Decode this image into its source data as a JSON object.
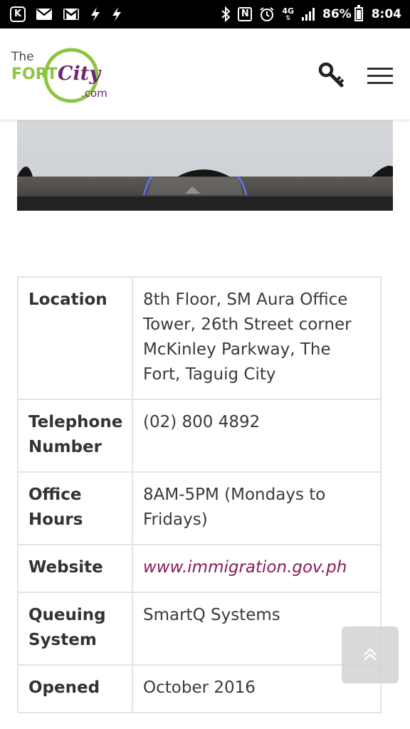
{
  "status_bar": {
    "left_icons": [
      "k-app-icon",
      "mail-icon",
      "gmail-icon",
      "flash-icon",
      "flash-icon"
    ],
    "right_icons": [
      "bluetooth-icon",
      "nfc-icon",
      "alarm-icon",
      "network-icon",
      "signal-icon",
      "battery-icon"
    ],
    "network_label": "4G",
    "battery_percent": "86%",
    "time": "8:04"
  },
  "header": {
    "logo": {
      "the": "The",
      "fort": "FORT",
      "city": "City",
      "dotcom": ".com"
    },
    "search_icon": "key-search-icon",
    "menu_icon": "hamburger-menu-icon"
  },
  "info_table": {
    "rows": [
      {
        "label": "Location",
        "value": "8th Floor, SM Aura Office Tower, 26th Street corner McKinley Parkway, The Fort, Taguig City"
      },
      {
        "label": "Telephone Number",
        "value": "(02) 800 4892"
      },
      {
        "label": "Office Hours",
        "value": "8AM-5PM (Mondays to Fridays)"
      },
      {
        "label": "Website",
        "value": "www.immigration.gov.ph"
      },
      {
        "label": "Queuing System",
        "value": "SmartQ Systems"
      },
      {
        "label": "Opened",
        "value": "October 2016"
      }
    ]
  },
  "colors": {
    "logo_green": "#8cc63f",
    "logo_dark": "#4a4a4a",
    "logo_purple": "#6b2a6e",
    "link": "#8b1a5a",
    "table_border": "#e4e4e4"
  },
  "back_to_top_icon": "chevron-up-icon"
}
